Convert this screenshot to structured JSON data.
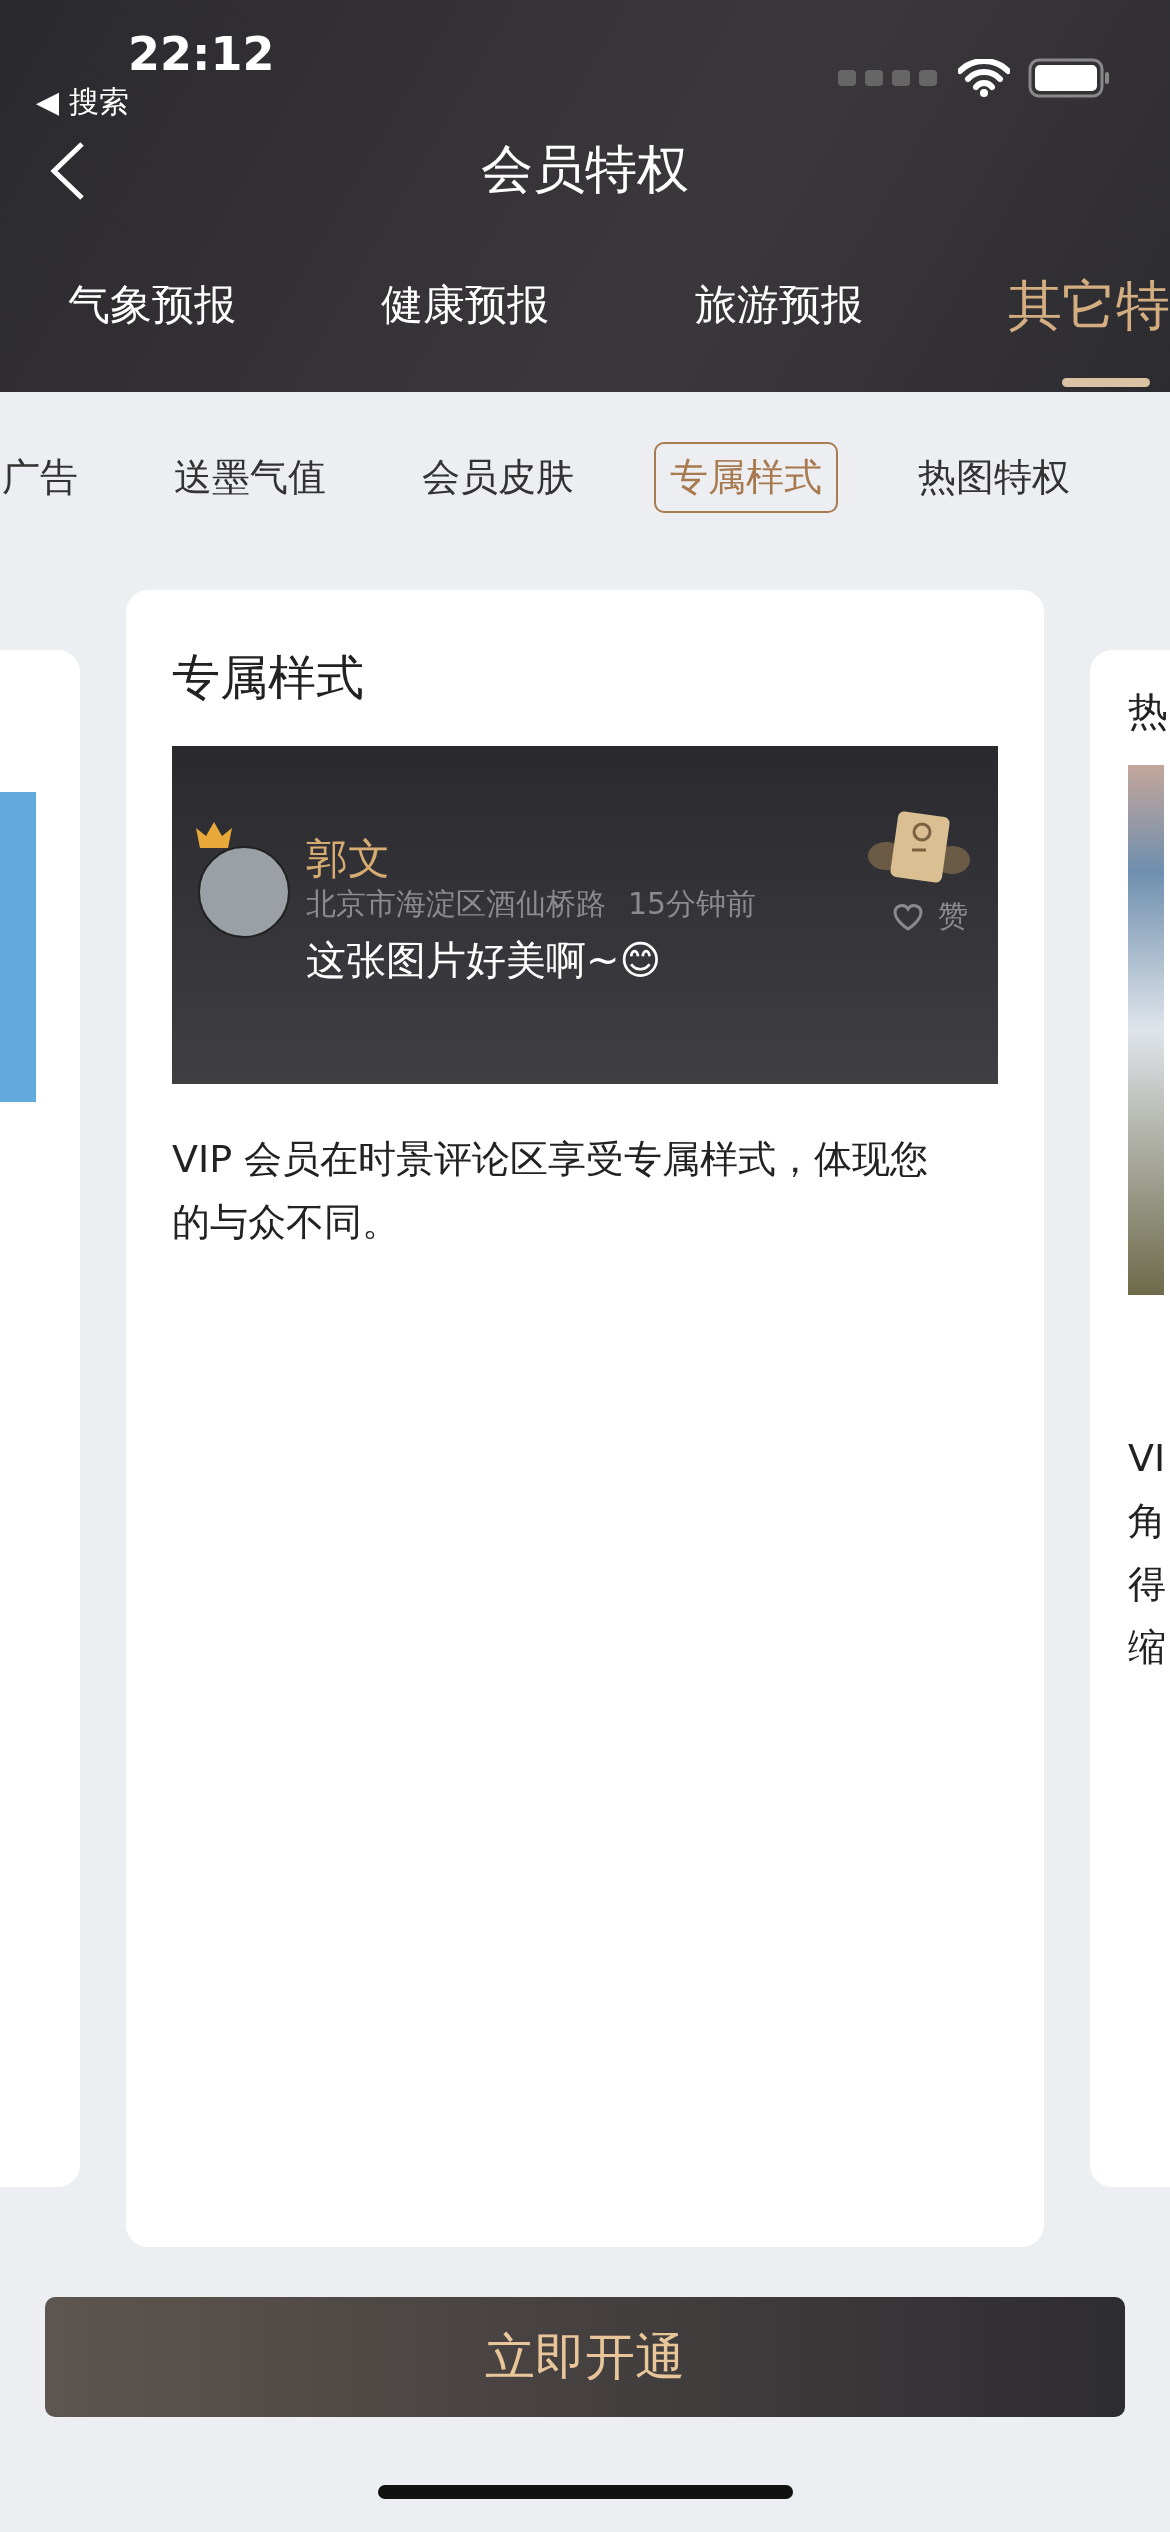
{
  "status_bar": {
    "time": "22:12",
    "back_app": "◀ 搜索"
  },
  "nav": {
    "title": "会员特权"
  },
  "category_tabs": [
    {
      "label": "气象预报",
      "selected": false
    },
    {
      "label": "健康预报",
      "selected": false
    },
    {
      "label": "旅游预报",
      "selected": false
    },
    {
      "label": "其它特",
      "selected": true
    }
  ],
  "privilege_tabs": [
    {
      "label": "广告",
      "selected": false
    },
    {
      "label": "送墨气值",
      "selected": false
    },
    {
      "label": "会员皮肤",
      "selected": false
    },
    {
      "label": "专属样式",
      "selected": true
    },
    {
      "label": "热图特权",
      "selected": false
    }
  ],
  "current_card": {
    "title": "专属样式",
    "preview": {
      "name": "郭文",
      "location": "北京市海淀区酒仙桥路",
      "time": "15分钟前",
      "like_label": "赞",
      "comment": "这张图片好美啊~😊"
    },
    "description": "VIP 会员在时景评论区享受专属样式，体现您的与众不同。"
  },
  "next_card": {
    "title": "热",
    "description_lines": [
      "VI",
      "角",
      "得",
      "缩"
    ]
  },
  "cta": "立即开通"
}
